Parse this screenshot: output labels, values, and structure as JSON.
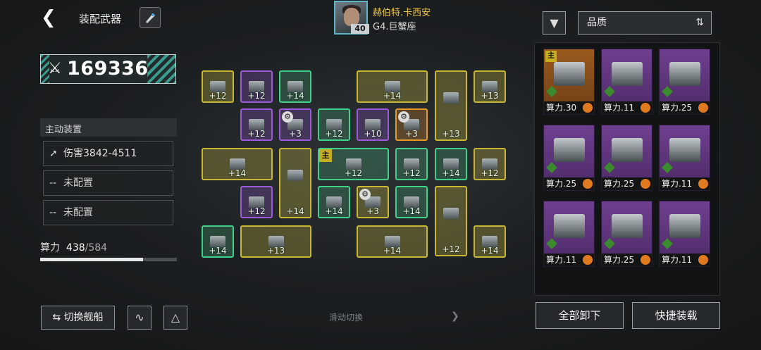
{
  "header": {
    "title": "装配武器",
    "back_icon": "chevron-left-icon",
    "rocket_icon": "rocket-icon"
  },
  "commander": {
    "name": "赫伯特.卡西安",
    "subtitle": "G4.巨蟹座",
    "level": "40"
  },
  "power": {
    "value": "169336",
    "icon": "crossed-swords-icon"
  },
  "active": {
    "header": "主动装置",
    "slots": [
      {
        "label": "伤害3842-4511",
        "icon": "missile-icon"
      },
      {
        "label": "未配置",
        "icon": "dash"
      },
      {
        "label": "未配置",
        "icon": "dash"
      }
    ]
  },
  "capacity": {
    "label": "算力",
    "current": "438",
    "max": "/584",
    "fraction": 0.75
  },
  "buttons": {
    "switch_ship": "切换舰船",
    "unload_all": "全部卸下",
    "quick_equip": "快捷装载"
  },
  "swipe_hint": "滑动切换",
  "filter": {
    "quality_label": "品质"
  },
  "grid_tiles": [
    {
      "level": "+12",
      "tone": "gold"
    },
    {
      "level": "+12",
      "tone": "purple"
    },
    {
      "level": "+14",
      "tone": "green"
    },
    {
      "level": "+14",
      "tone": "gold"
    },
    {
      "level": "+13",
      "tone": "gold"
    },
    {
      "level": "+13",
      "tone": "gold"
    },
    {
      "level": "+12",
      "tone": "purple"
    },
    {
      "level": "+3",
      "tone": "purple",
      "gear": true
    },
    {
      "level": "+12",
      "tone": "green"
    },
    {
      "level": "+10",
      "tone": "purple"
    },
    {
      "level": "+3",
      "tone": "orange",
      "gear": true
    },
    {
      "level": "+14",
      "tone": "gold"
    },
    {
      "level": "+14",
      "tone": "gold"
    },
    {
      "level": "+12",
      "tone": "green",
      "main": true,
      "main_label": "主"
    },
    {
      "level": "+12",
      "tone": "green"
    },
    {
      "level": "+14",
      "tone": "green"
    },
    {
      "level": "+12",
      "tone": "gold"
    },
    {
      "level": "+12",
      "tone": "purple"
    },
    {
      "level": "+14",
      "tone": "green"
    },
    {
      "level": "+3",
      "tone": "gold",
      "gear": true
    },
    {
      "level": "+14",
      "tone": "green"
    },
    {
      "level": "+12",
      "tone": "gold"
    },
    {
      "level": "+14",
      "tone": "green"
    },
    {
      "level": "+13",
      "tone": "gold"
    },
    {
      "level": "+14",
      "tone": "gold"
    },
    {
      "level": "+14",
      "tone": "gold"
    }
  ],
  "inventory": [
    {
      "label": "算力.30",
      "tone": "orange",
      "tag": "主"
    },
    {
      "label": "算力.11",
      "tone": "purple"
    },
    {
      "label": "算力.25",
      "tone": "purple"
    },
    {
      "label": "算力.25",
      "tone": "purple"
    },
    {
      "label": "算力.25",
      "tone": "purple"
    },
    {
      "label": "算力.11",
      "tone": "purple"
    },
    {
      "label": "算力.11",
      "tone": "purple"
    },
    {
      "label": "算力.25",
      "tone": "purple"
    },
    {
      "label": "算力.11",
      "tone": "purple"
    }
  ]
}
